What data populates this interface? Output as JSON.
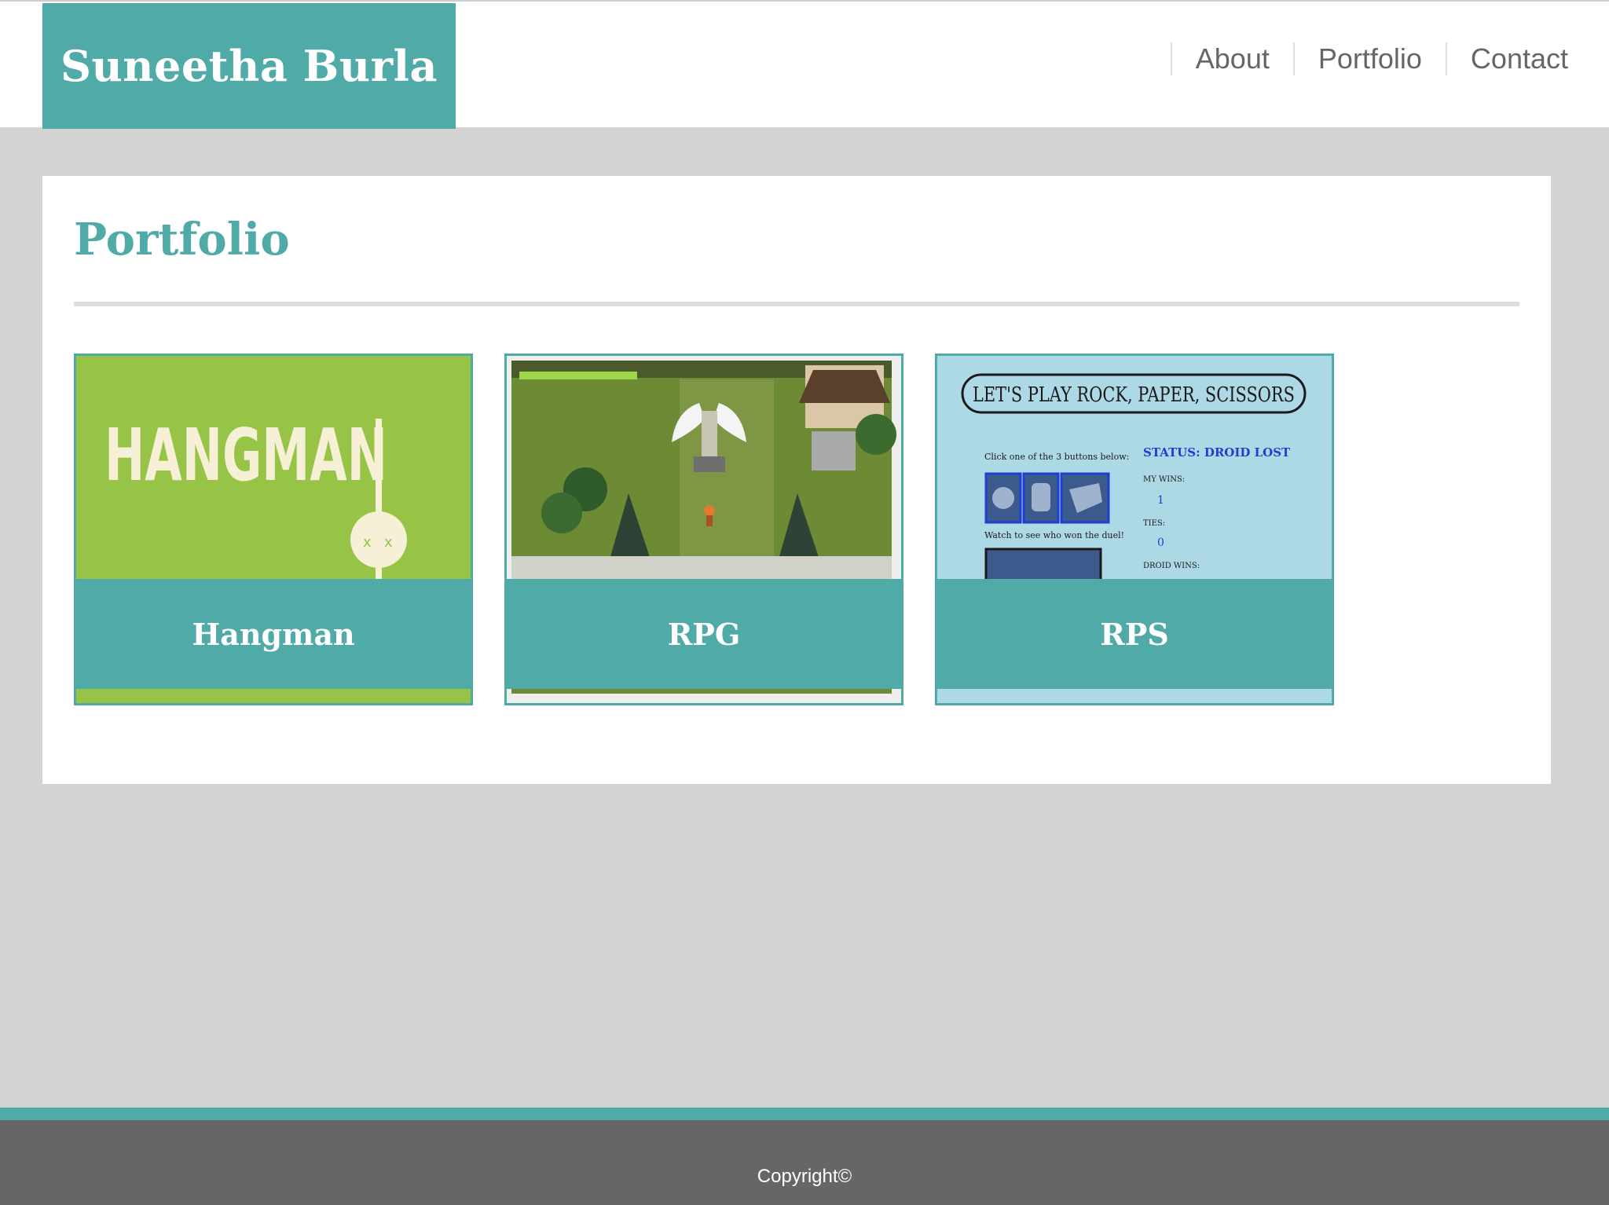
{
  "header": {
    "brand": "Suneetha Burla",
    "nav": [
      "About",
      "Portfolio",
      "Contact"
    ]
  },
  "main": {
    "title": "Portfolio",
    "projects": [
      {
        "label": "Hangman",
        "thumb_text": "HANGMAN",
        "thumb_icon": "dead-face-icon",
        "thumb_bg": "#97c447"
      },
      {
        "label": "RPG",
        "thumb_icon": "game-map-icon",
        "thumb_bg": "#6d8a35"
      },
      {
        "label": "RPS",
        "thumb_heading": "LET'S PLAY ROCK, PAPER, SCISSORS",
        "thumb_instructions": "Click one of the 3 buttons below:",
        "thumb_watch": "Watch to see who won the duel!",
        "thumb_status": "STATUS: DROID LOST",
        "thumb_my_wins_label": "MY WINS:",
        "thumb_my_wins": "1",
        "thumb_ties_label": "TIES:",
        "thumb_ties": "0",
        "thumb_droid_wins_label": "DROID WINS:",
        "thumb_bg": "#add8e6"
      }
    ]
  },
  "footer": {
    "copyright": "Copyright©"
  },
  "colors": {
    "accent": "#50aaa7",
    "page_bg": "#d3d3d3",
    "footer_bg": "#666666"
  }
}
